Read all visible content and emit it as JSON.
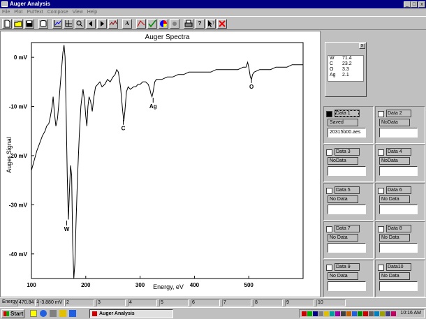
{
  "window": {
    "title": "Auger Analysis",
    "buttons": [
      "_",
      "□",
      "x"
    ]
  },
  "menu": [
    "File",
    "Plot",
    "PutText",
    "Compose",
    "View",
    "Help"
  ],
  "toolbar": {
    "text_tool": "A"
  },
  "chart_data": {
    "type": "line",
    "title": "Auger Spectra",
    "xlabel": "Energy, eV",
    "ylabel": "Auger Signal",
    "xlim": [
      100,
      600
    ],
    "ylim": [
      -45,
      3
    ],
    "x_ticks": [
      100,
      200,
      300,
      400,
      500
    ],
    "y_ticks": [
      0,
      -10,
      -20,
      -30,
      -40
    ],
    "y_tick_labels": [
      "0 mV",
      "-10 mV",
      "-20 mV",
      "-30 mV",
      "-40 mV"
    ],
    "grid": false,
    "series": [
      {
        "name": "",
        "points": [
          [
            100,
            -23
          ],
          [
            105,
            -21
          ],
          [
            110,
            -19
          ],
          [
            115,
            -17.5
          ],
          [
            120,
            -16
          ],
          [
            125,
            -15
          ],
          [
            128,
            -14
          ],
          [
            132,
            -13.5
          ],
          [
            135,
            -12
          ],
          [
            138,
            -10
          ],
          [
            140,
            -8
          ],
          [
            142,
            -11
          ],
          [
            145,
            -14
          ],
          [
            148,
            -12.5
          ],
          [
            150,
            -10
          ],
          [
            152,
            -7
          ],
          [
            155,
            -3
          ],
          [
            158,
            1
          ],
          [
            160,
            2.5
          ],
          [
            162,
            0
          ],
          [
            164,
            -12
          ],
          [
            166,
            -24
          ],
          [
            168,
            -33
          ],
          [
            170,
            -27
          ],
          [
            172,
            -22
          ],
          [
            174,
            -24
          ],
          [
            176,
            -38
          ],
          [
            178,
            -45
          ],
          [
            180,
            -42
          ],
          [
            182,
            -34
          ],
          [
            185,
            -24
          ],
          [
            188,
            -16
          ],
          [
            191,
            -10
          ],
          [
            193,
            -8
          ],
          [
            195,
            -6.5
          ],
          [
            198,
            -9
          ],
          [
            200,
            -12
          ],
          [
            202,
            -14
          ],
          [
            204,
            -10
          ],
          [
            206,
            -8
          ],
          [
            209,
            -9
          ],
          [
            212,
            -11
          ],
          [
            215,
            -8
          ],
          [
            218,
            -6
          ],
          [
            222,
            -5.5
          ],
          [
            226,
            -5
          ],
          [
            230,
            -6
          ],
          [
            235,
            -5.5
          ],
          [
            240,
            -4.5
          ],
          [
            245,
            -5
          ],
          [
            250,
            -4
          ],
          [
            254,
            -3.5
          ],
          [
            257,
            -2.5
          ],
          [
            260,
            -3
          ],
          [
            264,
            -6
          ],
          [
            268,
            -11
          ],
          [
            270,
            -13
          ],
          [
            272,
            -11
          ],
          [
            275,
            -7
          ],
          [
            278,
            -6
          ],
          [
            282,
            -6.5
          ],
          [
            288,
            -6
          ],
          [
            292,
            -6
          ],
          [
            296,
            -5.5
          ],
          [
            300,
            -5.5
          ],
          [
            305,
            -5
          ],
          [
            310,
            -5
          ],
          [
            315,
            -5.5
          ],
          [
            318,
            -6.5
          ],
          [
            320,
            -7.5
          ],
          [
            322,
            -8
          ],
          [
            324,
            -7
          ],
          [
            327,
            -5
          ],
          [
            330,
            -4.5
          ],
          [
            340,
            -4.5
          ],
          [
            350,
            -4
          ],
          [
            360,
            -4
          ],
          [
            370,
            -3.5
          ],
          [
            380,
            -3.5
          ],
          [
            390,
            -3
          ],
          [
            400,
            -3
          ],
          [
            410,
            -3
          ],
          [
            420,
            -3
          ],
          [
            430,
            -3
          ],
          [
            440,
            -2.5
          ],
          [
            450,
            -2.5
          ],
          [
            460,
            -2.5
          ],
          [
            470,
            -2.5
          ],
          [
            480,
            -2.5
          ],
          [
            490,
            -2
          ],
          [
            495,
            -2
          ],
          [
            498,
            -1
          ],
          [
            500,
            -2
          ],
          [
            503,
            -4
          ],
          [
            505,
            -4.5
          ],
          [
            507,
            -3.5
          ],
          [
            510,
            -3
          ],
          [
            520,
            -2.5
          ],
          [
            530,
            -2.5
          ],
          [
            540,
            -2.5
          ],
          [
            550,
            -2
          ],
          [
            560,
            -2
          ],
          [
            570,
            -2
          ],
          [
            580,
            -1.5
          ],
          [
            590,
            -1.5
          ],
          [
            600,
            -1.5
          ]
        ]
      }
    ],
    "annotations": [
      {
        "text": "W",
        "x": 165,
        "y": -34.5
      },
      {
        "text": "C",
        "x": 269,
        "y": -14
      },
      {
        "text": "Ag",
        "x": 324,
        "y": -9.5
      },
      {
        "text": "O",
        "x": 505,
        "y": -5.5
      }
    ]
  },
  "legend_window": {
    "close": "x",
    "entries": [
      {
        "element": "W",
        "value": "71.4"
      },
      {
        "element": "C",
        "value": "23.2"
      },
      {
        "element": "O",
        "value": "3.3"
      },
      {
        "element": "Ag",
        "value": "2.1"
      }
    ]
  },
  "data_slots": [
    {
      "label": "Data 1",
      "status": "Saved",
      "file": "20315b00.aes",
      "checked": true
    },
    {
      "label": "Data 2",
      "status": "NoData",
      "file": "",
      "checked": false
    },
    {
      "label": "Data 3",
      "status": "NoData",
      "file": "",
      "checked": false
    },
    {
      "label": "Data 4",
      "status": "NoData",
      "file": "",
      "checked": false
    },
    {
      "label": "Data 5",
      "status": "No Data",
      "file": "",
      "checked": false
    },
    {
      "label": "Data 6",
      "status": "No Data",
      "file": "",
      "checked": false
    },
    {
      "label": "Data 7",
      "status": "No Data",
      "file": "",
      "checked": false
    },
    {
      "label": "Data 8",
      "status": "No Data",
      "file": "",
      "checked": false
    },
    {
      "label": "Data 9",
      "status": "No Data",
      "file": "",
      "checked": false
    },
    {
      "label": "Data10",
      "status": "No Data",
      "file": "",
      "checked": false
    }
  ],
  "statusbar": {
    "energy_label": "Energy",
    "energy_value": "470.84",
    "signal_value": "-3.880 mV",
    "markers": [
      "1",
      "2",
      "3",
      "4",
      "5",
      "6",
      "7",
      "8",
      "9",
      "10"
    ]
  },
  "taskbar": {
    "start": "Start",
    "task": "Auger Analysis",
    "clock": "10:16 AM"
  }
}
